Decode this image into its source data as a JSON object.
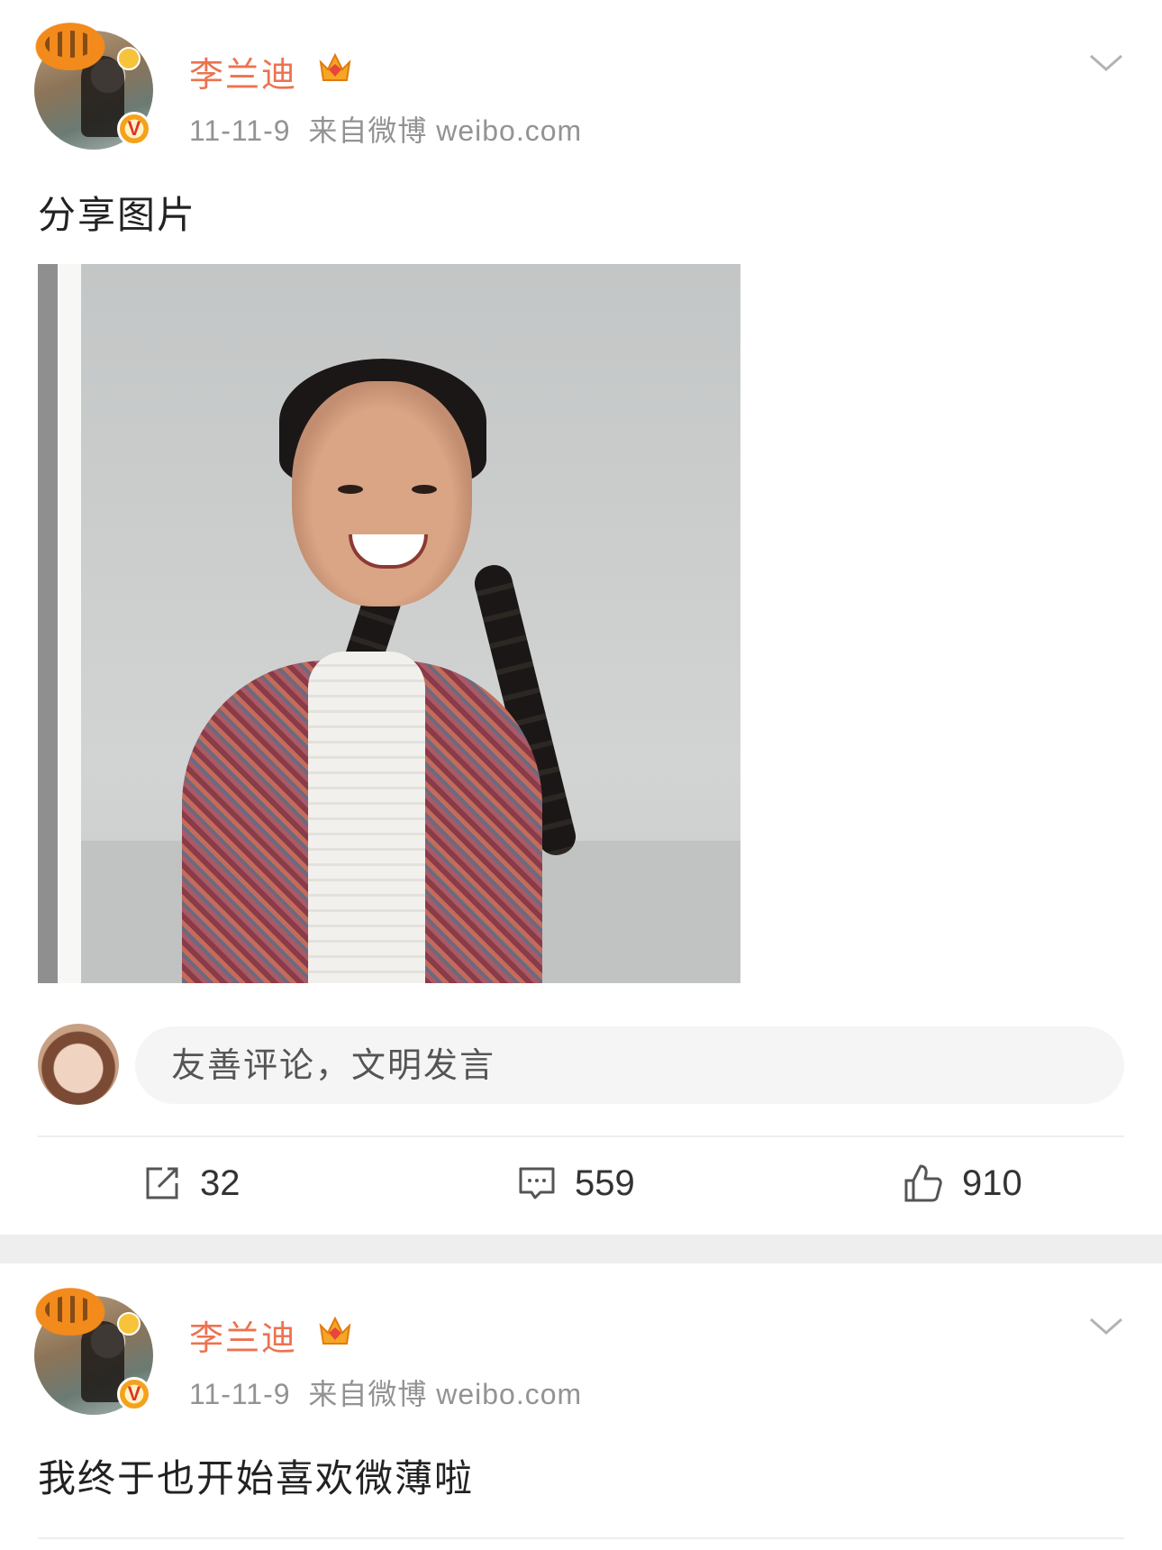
{
  "posts": [
    {
      "author": "李兰迪",
      "date": "11-11-9",
      "source": "来自微博 weibo.com",
      "text": "分享图片",
      "verified_badge": "V",
      "comment_placeholder": "友善评论，文明发言",
      "stats": {
        "reposts": "32",
        "comments": "559",
        "likes": "910"
      }
    },
    {
      "author": "李兰迪",
      "date": "11-11-9",
      "source": "来自微博 weibo.com",
      "text": "我终于也开始喜欢微薄啦",
      "verified_badge": "V"
    }
  ],
  "colors": {
    "author": "#eb7350",
    "meta": "#939393",
    "divider": "#eeeeee",
    "input_bg": "#f5f5f5",
    "verified": "#f4a21b"
  },
  "icons": [
    "crown-icon",
    "chevron-down-icon",
    "repost-icon",
    "comment-icon",
    "like-icon",
    "verified-badge-icon"
  ]
}
